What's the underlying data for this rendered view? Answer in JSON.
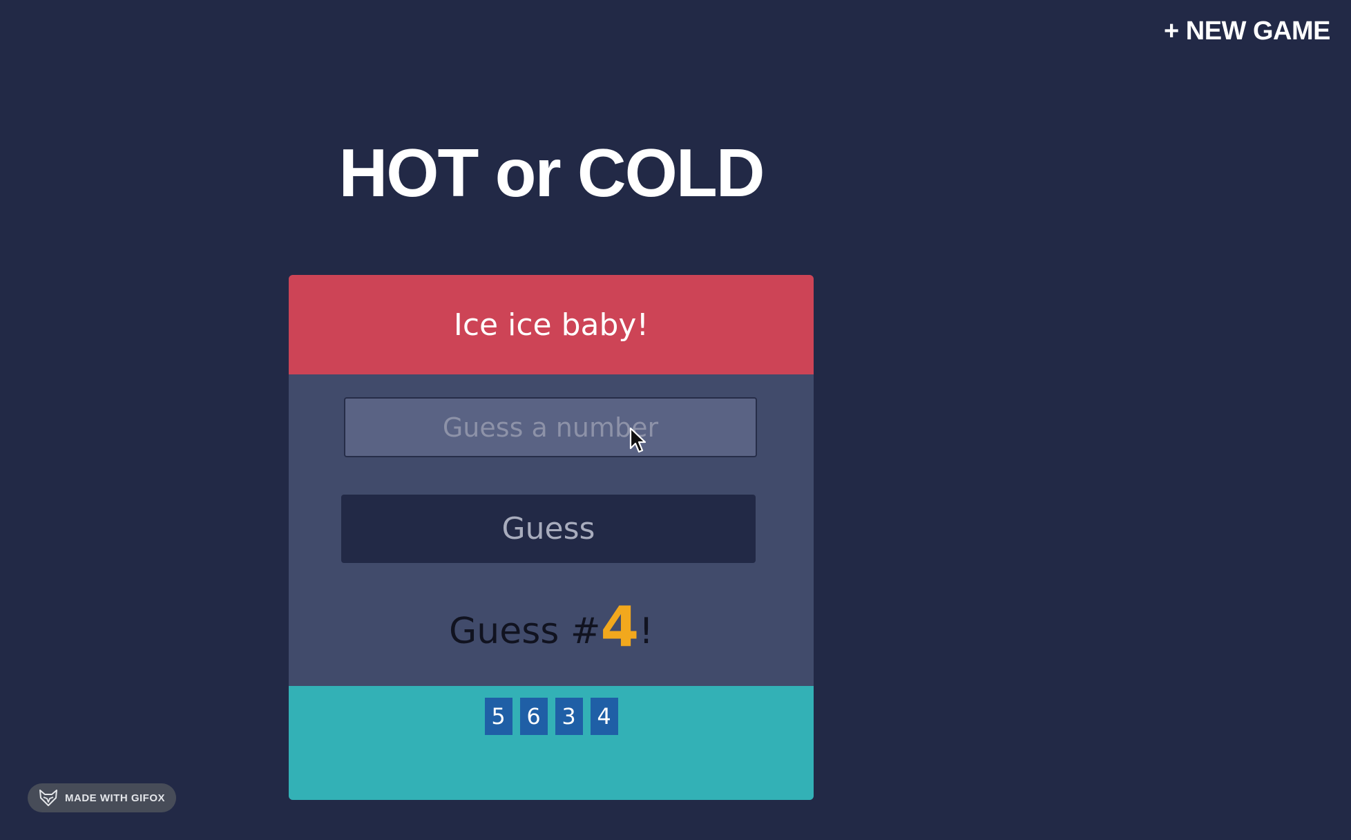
{
  "header": {
    "new_game_label": "+ NEW GAME"
  },
  "title": "HOT or COLD",
  "feedback": {
    "message": "Ice ice baby!"
  },
  "guess_input": {
    "placeholder": "Guess a number",
    "value": ""
  },
  "guess_button": {
    "label": "Guess"
  },
  "guess_count": {
    "prefix": "Guess #",
    "number": "4",
    "suffix": "!"
  },
  "history": [
    "5",
    "6",
    "3",
    "4"
  ],
  "badge": {
    "label": "MADE WITH GIFOX",
    "icon": "fox-icon"
  },
  "colors": {
    "background": "#222946",
    "feedback_bg": "#cd4456",
    "panel_bg": "#414b6b",
    "history_bg": "#33b1b6",
    "chip_bg": "#1f5fa6",
    "count_accent": "#f2a81d"
  }
}
